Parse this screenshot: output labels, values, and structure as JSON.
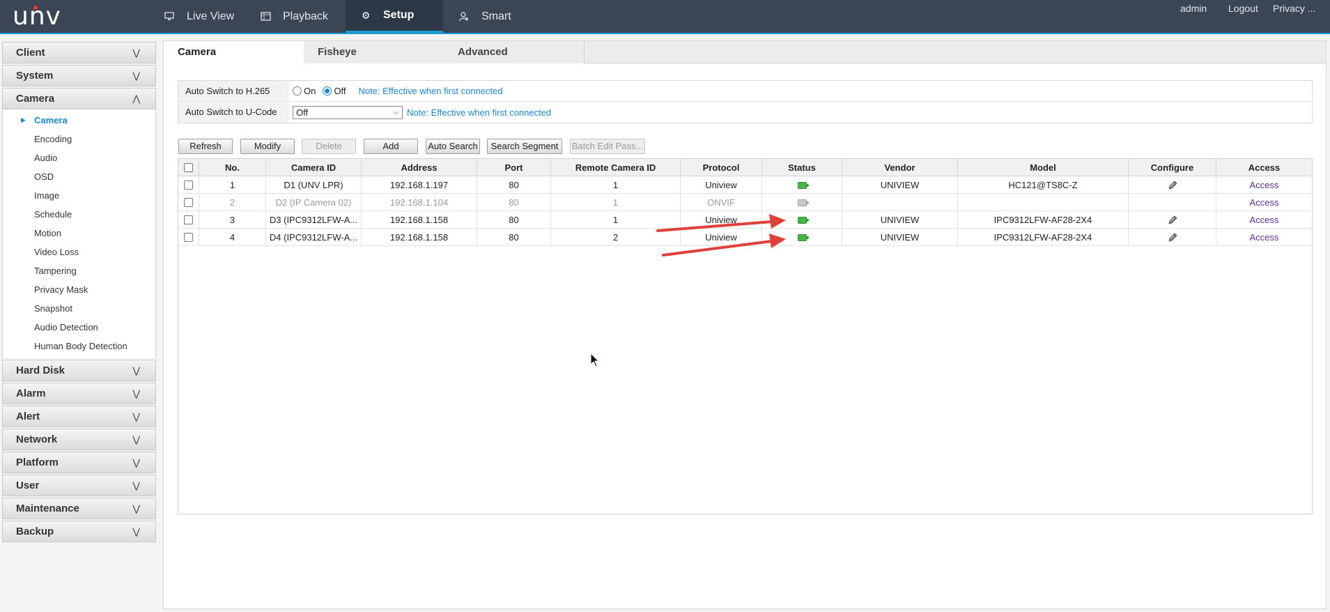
{
  "app": {
    "logo": "unv"
  },
  "nav": {
    "live_view": "Live View",
    "playback": "Playback",
    "setup": "Setup",
    "smart": "Smart"
  },
  "user_menu": {
    "user": "admin",
    "logout": "Logout",
    "privacy": "Privacy ..."
  },
  "sidebar": {
    "client": "Client",
    "system": "System",
    "camera": "Camera",
    "camera_items": [
      "Camera",
      "Encoding",
      "Audio",
      "OSD",
      "Image",
      "Schedule",
      "Motion",
      "Video Loss",
      "Tampering",
      "Privacy Mask",
      "Snapshot",
      "Audio Detection",
      "Human Body Detection"
    ],
    "hard_disk": "Hard Disk",
    "alarm": "Alarm",
    "alert": "Alert",
    "network": "Network",
    "platform": "Platform",
    "user": "User",
    "maintenance": "Maintenance",
    "backup": "Backup"
  },
  "tabs": {
    "camera": "Camera",
    "fisheye": "Fisheye",
    "advanced": "Advanced"
  },
  "settings": {
    "h265_label": "Auto Switch to H.265",
    "h265_on": "On",
    "h265_off": "Off",
    "h265_note": "Note: Effective when first connected",
    "ucode_label": "Auto Switch to U-Code",
    "ucode_value": "Off",
    "ucode_note": "Note: Effective when first connected"
  },
  "toolbar": {
    "refresh": "Refresh",
    "modify": "Modify",
    "delete": "Delete",
    "add": "Add",
    "auto_search": "Auto Search",
    "search_segment": "Search Segment",
    "batch_edit": "Batch Edit Pass..."
  },
  "table": {
    "headers": {
      "no": "No.",
      "camera_id": "Camera ID",
      "address": "Address",
      "port": "Port",
      "remote_id": "Remote Camera ID",
      "protocol": "Protocol",
      "status": "Status",
      "vendor": "Vendor",
      "model": "Model",
      "configure": "Configure",
      "access": "Access"
    },
    "rows": [
      {
        "no": "1",
        "camera_id": "D1 (UNV LPR)",
        "address": "192.168.1.197",
        "port": "80",
        "remote_id": "1",
        "protocol": "Uniview",
        "status": "online",
        "vendor": "UNIVIEW",
        "model": "HC121@TS8C-Z",
        "access": "Access"
      },
      {
        "no": "2",
        "camera_id": "D2 (IP Camera 02)",
        "address": "192.168.1.104",
        "port": "80",
        "remote_id": "1",
        "protocol": "ONVIF",
        "status": "offline",
        "vendor": "",
        "model": "",
        "access": "Access"
      },
      {
        "no": "3",
        "camera_id": "D3 (IPC9312LFW-A...",
        "address": "192.168.1.158",
        "port": "80",
        "remote_id": "1",
        "protocol": "Uniview",
        "status": "online",
        "vendor": "UNIVIEW",
        "model": "IPC9312LFW-AF28-2X4",
        "access": "Access"
      },
      {
        "no": "4",
        "camera_id": "D4 (IPC9312LFW-A...",
        "address": "192.168.1.158",
        "port": "80",
        "remote_id": "2",
        "protocol": "Uniview",
        "status": "online",
        "vendor": "UNIVIEW",
        "model": "IPC9312LFW-AF28-2X4",
        "access": "Access"
      }
    ]
  },
  "colors": {
    "accent": "#1b86c9",
    "topbar": "#3a4654",
    "status_online": "#47b847",
    "annotation_arrow": "#e0403a"
  }
}
